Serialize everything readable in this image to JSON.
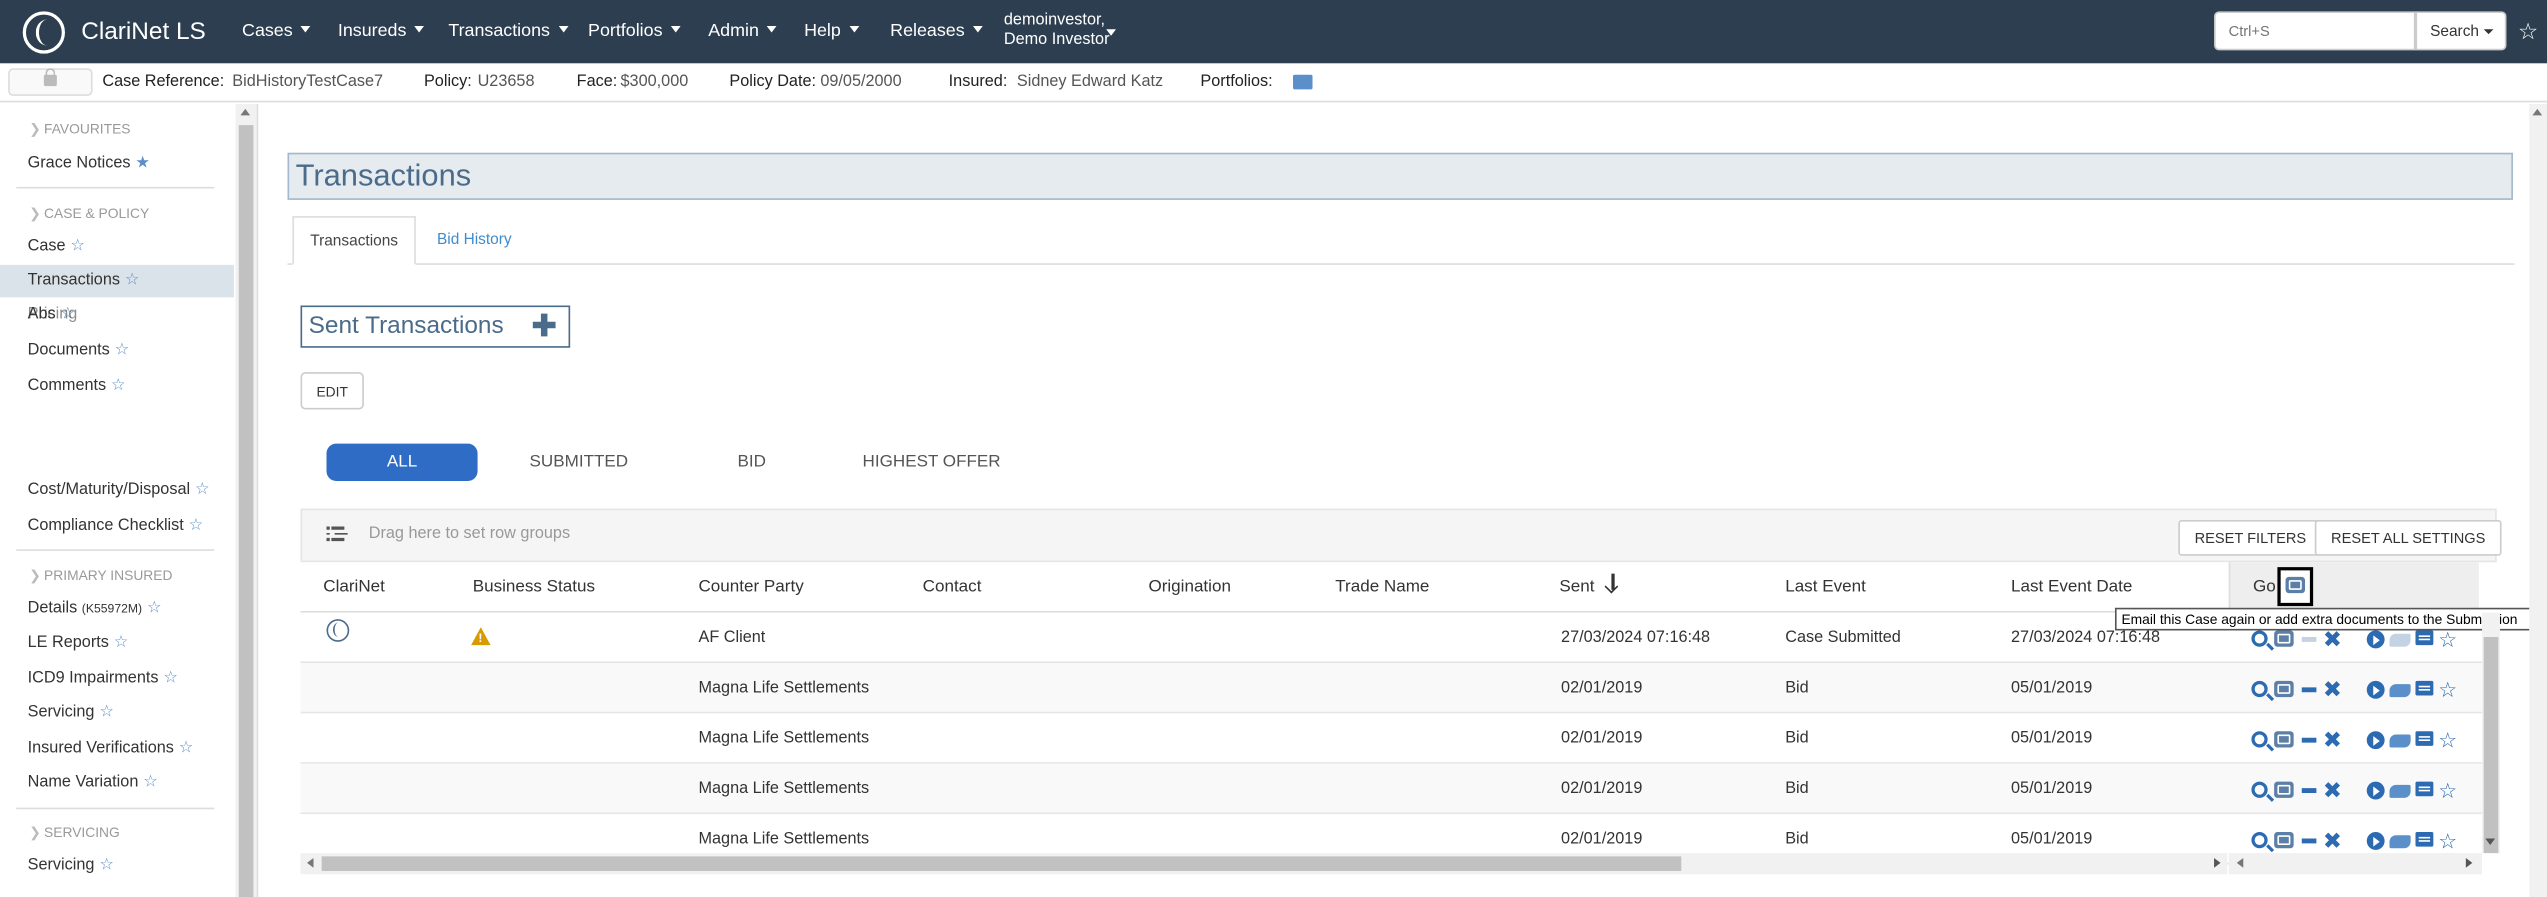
{
  "app": {
    "brand": "ClariNet LS"
  },
  "nav": {
    "menus": [
      {
        "label": "Cases"
      },
      {
        "label": "Insureds"
      },
      {
        "label": "Transactions"
      },
      {
        "label": "Portfolios"
      },
      {
        "label": "Admin"
      },
      {
        "label": "Help"
      },
      {
        "label": "Releases"
      }
    ],
    "user_line1": "demoinvestor,",
    "user_line2": "Demo Investor",
    "search_placeholder": "Ctrl+S",
    "search_button": "Search",
    "star": "☆"
  },
  "case": {
    "ref_label": "Case Reference:",
    "ref_value": "BidHistoryTestCase7",
    "policy_label": "Policy:",
    "policy_value": "U23658",
    "face_label": "Face:",
    "face_value": "$300,000",
    "policydate_label": "Policy Date:",
    "policydate_value": "09/05/2000",
    "insured_label": "Insured:",
    "insured_value": "Sidney Edward Katz",
    "portfolios_label": "Portfolios:"
  },
  "sidebar": {
    "favourites": "FAVOURITES",
    "grace": "Grace Notices",
    "case_policy": "CASE & POLICY",
    "case": "Case",
    "transactions": "Transactions",
    "abs": "Abs",
    "pricing": "Pricing",
    "documents": "Documents",
    "comments": "Comments",
    "cost": "Cost/Maturity/Disposal",
    "compliance": "Compliance Checklist",
    "primary": "PRIMARY INSURED",
    "details": "Details",
    "details_id": "(K55972M)",
    "le": "LE Reports",
    "icd9": "ICD9 Impairments",
    "servicing": "Servicing",
    "verifications": "Insured Verifications",
    "namevar": "Name Variation",
    "servicing_head": "SERVICING",
    "servicing2": "Servicing",
    "star_filled": "★",
    "star_empty": "☆"
  },
  "main": {
    "title": "Transactions",
    "tabs": [
      "Transactions",
      "Bid History"
    ],
    "sent_title": "Sent Transactions",
    "edit": "EDIT",
    "filters": [
      "ALL",
      "SUBMITTED",
      "BID",
      "HIGHEST OFFER"
    ],
    "group_placeholder": "Drag here to set row groups",
    "reset_filters": "RESET FILTERS",
    "reset_all": "RESET ALL SETTINGS",
    "columns": [
      "ClariNet",
      "Business Status",
      "Counter Party",
      "Contact",
      "Origination",
      "Trade Name",
      "Sent",
      "Last Event",
      "Last Event Date",
      "Go"
    ],
    "rows": [
      {
        "counter_party": "AF Client",
        "sent": "27/03/2024 07:16:48",
        "last_event": "Case Submitted",
        "last_event_date": "27/03/2024 07:16:48"
      },
      {
        "counter_party": "Magna Life Settlements",
        "sent": "02/01/2019",
        "last_event": "Bid",
        "last_event_date": "05/01/2019"
      },
      {
        "counter_party": "Magna Life Settlements",
        "sent": "02/01/2019",
        "last_event": "Bid",
        "last_event_date": "05/01/2019"
      },
      {
        "counter_party": "Magna Life Settlements",
        "sent": "02/01/2019",
        "last_event": "Bid",
        "last_event_date": "05/01/2019"
      },
      {
        "counter_party": "Magna Life Settlements",
        "sent": "02/01/2019",
        "last_event": "Bid",
        "last_event_date": "05/01/2019"
      }
    ],
    "tooltip": "Email this Case again or add extra documents to the Submission",
    "action_close": "✖",
    "action_star": "☆"
  },
  "colors": {
    "nav_bg": "#2c3e50",
    "accent": "#2e6cc6",
    "title": "#4a6b8a",
    "warning": "#d79b00"
  }
}
